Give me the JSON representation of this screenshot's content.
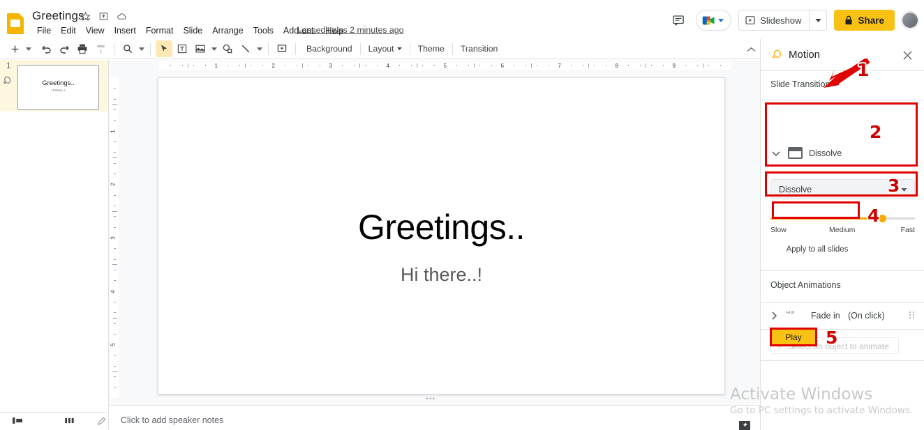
{
  "app": {
    "doc_title": "Greetings..",
    "logo_name": "google-slides-logo",
    "last_edit": "Last edit was 2 minutes ago"
  },
  "title_icons": [
    {
      "name": "star-icon",
      "glyph": "☆"
    },
    {
      "name": "move-to-folder-icon",
      "glyph": "▣"
    },
    {
      "name": "cloud-saved-icon",
      "glyph": "☁"
    }
  ],
  "menubar": [
    {
      "label": "File"
    },
    {
      "label": "Edit"
    },
    {
      "label": "View"
    },
    {
      "label": "Insert"
    },
    {
      "label": "Format"
    },
    {
      "label": "Slide"
    },
    {
      "label": "Arrange"
    },
    {
      "label": "Tools"
    },
    {
      "label": "Add-ons"
    },
    {
      "label": "Help"
    }
  ],
  "topright": {
    "comment_icon": "comment-icon",
    "meet_icon": "google-meet-icon",
    "slideshow_label": "Slideshow",
    "share_label": "Share",
    "share_color": "#f9c114",
    "avatar_name": "user-avatar"
  },
  "toolbar": {
    "buttons": [
      {
        "name": "new-slide-button",
        "icon": "plus-icon"
      },
      {
        "name": "new-slide-dropdown",
        "icon": "caret-down-icon"
      },
      {
        "name": "undo-button",
        "icon": "undo-icon"
      },
      {
        "name": "redo-button",
        "icon": "redo-icon"
      },
      {
        "name": "print-button",
        "icon": "printer-icon"
      },
      {
        "name": "paint-format-button",
        "icon": "paint-roller-icon"
      },
      {
        "name": "zoom-button",
        "icon": "magnifier-icon"
      },
      {
        "name": "zoom-dropdown",
        "icon": "caret-down-icon"
      },
      {
        "name": "select-tool-button",
        "icon": "cursor-arrow-icon"
      },
      {
        "name": "text-box-button",
        "icon": "text-box-icon"
      },
      {
        "name": "insert-image-button",
        "icon": "image-icon"
      },
      {
        "name": "insert-image-dropdown",
        "icon": "caret-down-icon"
      },
      {
        "name": "shape-button",
        "icon": "shape-icon"
      },
      {
        "name": "line-button",
        "icon": "line-icon"
      },
      {
        "name": "line-dropdown",
        "icon": "caret-down-icon"
      },
      {
        "name": "add-comment-button",
        "icon": "add-comment-icon"
      }
    ],
    "text_buttons": [
      {
        "name": "background-button",
        "label": "Background",
        "caret": false
      },
      {
        "name": "layout-button",
        "label": "Layout",
        "caret": true
      },
      {
        "name": "theme-button",
        "label": "Theme",
        "caret": false
      },
      {
        "name": "transition-button",
        "label": "Transition",
        "caret": false
      }
    ],
    "collapse_icon": "chevron-up-icon"
  },
  "filmstrip": {
    "slides": [
      {
        "number": "1",
        "title": "Greetings..",
        "subtitle": "Hi there..!",
        "has_motion": true
      }
    ],
    "bottom_bar": [
      {
        "name": "filmstrip-view-button",
        "icon": "filmstrip-icon"
      },
      {
        "name": "grid-view-button",
        "icon": "grid-icon"
      },
      {
        "name": "edit-theme-button",
        "icon": "pencil-icon"
      }
    ]
  },
  "canvas": {
    "ruler_h_numbers": [
      "1",
      "2",
      "3",
      "4",
      "5",
      "6",
      "7",
      "8",
      "9"
    ],
    "ruler_v_numbers": [
      "1",
      "2",
      "3",
      "4",
      "5"
    ],
    "slide": {
      "title": "Greetings..",
      "subtitle": "Hi there..!"
    }
  },
  "notes": {
    "placeholder": "Click to add speaker notes"
  },
  "panel": {
    "icon": "motion-icon",
    "title": "Motion",
    "close_icon": "close-icon",
    "slide_transition_label": "Slide Transition",
    "transition": {
      "chevron_icon": "chevron-down-icon",
      "slide_icon": "slide-icon",
      "name": "Dissolve",
      "select_value": "Dissolve",
      "select_caret_icon": "caret-down-icon"
    },
    "speed": {
      "labels": [
        "Slow",
        "Medium",
        "Fast"
      ],
      "value_percent": 78,
      "accent_color": "#f9ab00"
    },
    "apply_all_label": "Apply to all slides",
    "object_animations_label": "Object Animations",
    "animations": [
      {
        "chevron_icon": "chevron-right-icon",
        "thumb_text": "Hi th",
        "name": "Fade in",
        "trigger": "(On click)",
        "grip_icon": "drag-handle-icon"
      }
    ],
    "select_object_label": "Select an object to animate",
    "play_label": "Play",
    "play_color": "#f9c114"
  },
  "annotations": {
    "color": "#e00000",
    "numbers": [
      "1",
      "2",
      "3",
      "4",
      "5"
    ]
  },
  "watermark": {
    "line1": "Activate Windows",
    "line2": "Go to PC settings to activate Windows."
  }
}
